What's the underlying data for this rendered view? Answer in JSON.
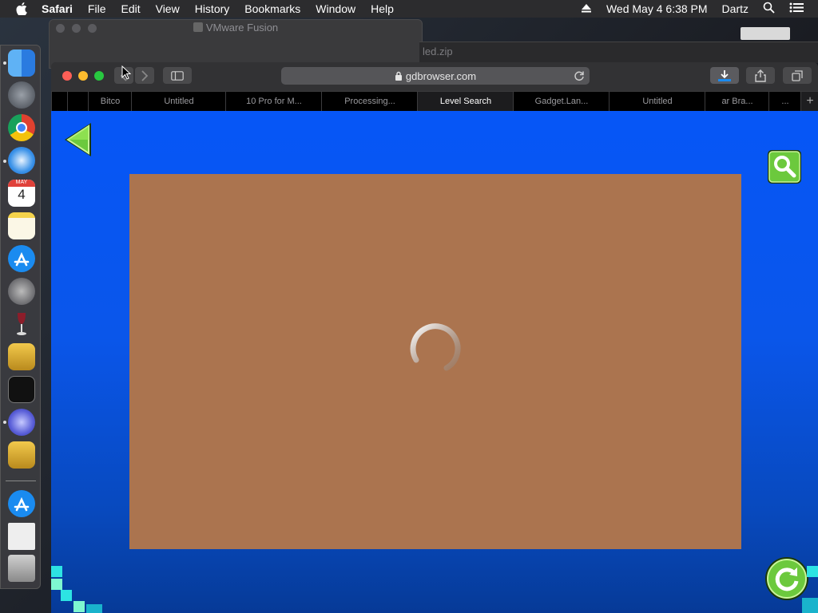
{
  "menubar": {
    "app_name": "Safari",
    "items": [
      "File",
      "Edit",
      "View",
      "History",
      "Bookmarks",
      "Window",
      "Help"
    ],
    "clock": "Wed May 4  6:38 PM",
    "user": "Dartz"
  },
  "background_windows": {
    "vmware_title": "VMware Fusion",
    "partial_title": "led.zip"
  },
  "dock": {
    "calendar_month": "MAY",
    "calendar_day": "4"
  },
  "safari": {
    "address": "gdbrowser.com",
    "tabs": [
      {
        "label": "Bitco",
        "active": false
      },
      {
        "label": "Untitled",
        "active": false
      },
      {
        "label": "10 Pro for M...",
        "active": false
      },
      {
        "label": "Processing...",
        "active": false
      },
      {
        "label": "Level Search",
        "active": true
      },
      {
        "label": "Gadget.Lan...",
        "active": false
      },
      {
        "label": "Untitled",
        "active": false
      },
      {
        "label": "ar Bra...",
        "active": false
      }
    ],
    "overflow_label": "...",
    "add_tab_label": "+"
  },
  "page": {
    "state": "loading",
    "accent_green": "#6cc93d",
    "frame_color": "#ab744f",
    "bg_color": "#0656f7"
  }
}
